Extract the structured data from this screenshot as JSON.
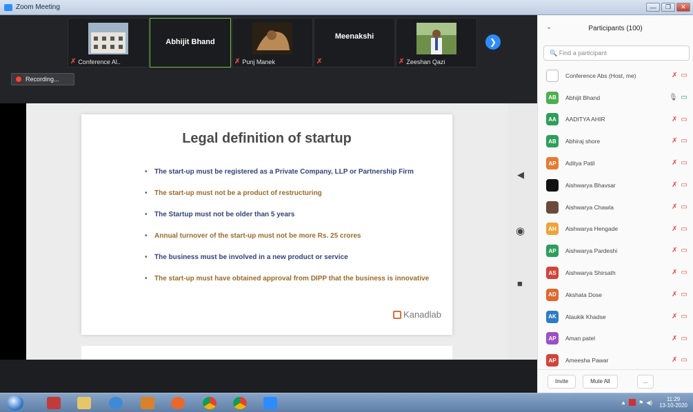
{
  "window": {
    "title": "Zoom Meeting",
    "minimize": "—",
    "maximize": "❐",
    "close": "✕"
  },
  "video_strip": {
    "tiles": [
      {
        "name": "Conference Al..",
        "has_photo": true
      },
      {
        "name": "Abhijit Bhand",
        "has_photo": false,
        "active": true
      },
      {
        "name": "Punj Manek",
        "has_photo": true
      },
      {
        "name": "Meenakshi",
        "has_photo": false
      },
      {
        "name": "Zeeshan Qazi",
        "has_photo": true
      }
    ],
    "next_icon": "chevron-right-icon"
  },
  "recording": {
    "label": "Recording..."
  },
  "slide": {
    "title": "Legal definition of startup",
    "bullets": [
      "The start-up must be registered as a Private Company, LLP or Partnership Firm",
      "The start-up must not be a product of restructuring",
      "The Startup must not be older than 5 years",
      "Annual turnover of the start-up must not be more Rs. 25 crores",
      "The business must be involved in a new product or service",
      "The start-up must have obtained approval from DIPP that the business is innovative"
    ],
    "logo": "Kanadlab"
  },
  "share_controls": {
    "prev": "◀",
    "pointer": "◉",
    "stop": "■"
  },
  "participants": {
    "header": "Participants (100)",
    "search_placeholder": "Find a participant",
    "list": [
      {
        "initials": "",
        "name": "Conference Abs (Host, me)",
        "color": "#ffffff"
      },
      {
        "initials": "AB",
        "name": "Abhijit Bhand",
        "color": "#4caf50"
      },
      {
        "initials": "AA",
        "name": "AADITYA AHIR",
        "color": "#2e9e5b"
      },
      {
        "initials": "AB",
        "name": "Abhiraj shore",
        "color": "#2e9e5b"
      },
      {
        "initials": "AP",
        "name": "Aditya Patil",
        "color": "#e87b2f"
      },
      {
        "initials": "",
        "name": "Aishwarya Bhavsar",
        "color": "#111111"
      },
      {
        "initials": "",
        "name": "Aishwarya Chawla",
        "color": "#6b4a3a"
      },
      {
        "initials": "AH",
        "name": "Aishwarya Hengade",
        "color": "#f0a33a"
      },
      {
        "initials": "AP",
        "name": "Aishwarya Pardeshi",
        "color": "#2e9e5b"
      },
      {
        "initials": "AS",
        "name": "Aishwarya Shirsath",
        "color": "#d2443a"
      },
      {
        "initials": "AD",
        "name": "Akshata Dose",
        "color": "#e0682f"
      },
      {
        "initials": "AK",
        "name": "Alaukik Khadse",
        "color": "#2f7cc4"
      },
      {
        "initials": "AP",
        "name": "Aman patel",
        "color": "#9b4fc4"
      },
      {
        "initials": "AP",
        "name": "Ameesha Pawar",
        "color": "#d2443a"
      }
    ],
    "invite_label": "Invite",
    "mute_all_label": "Mute All",
    "more_label": "..."
  },
  "taskbar": {
    "time": "11:29",
    "date": "13-10-2020"
  }
}
